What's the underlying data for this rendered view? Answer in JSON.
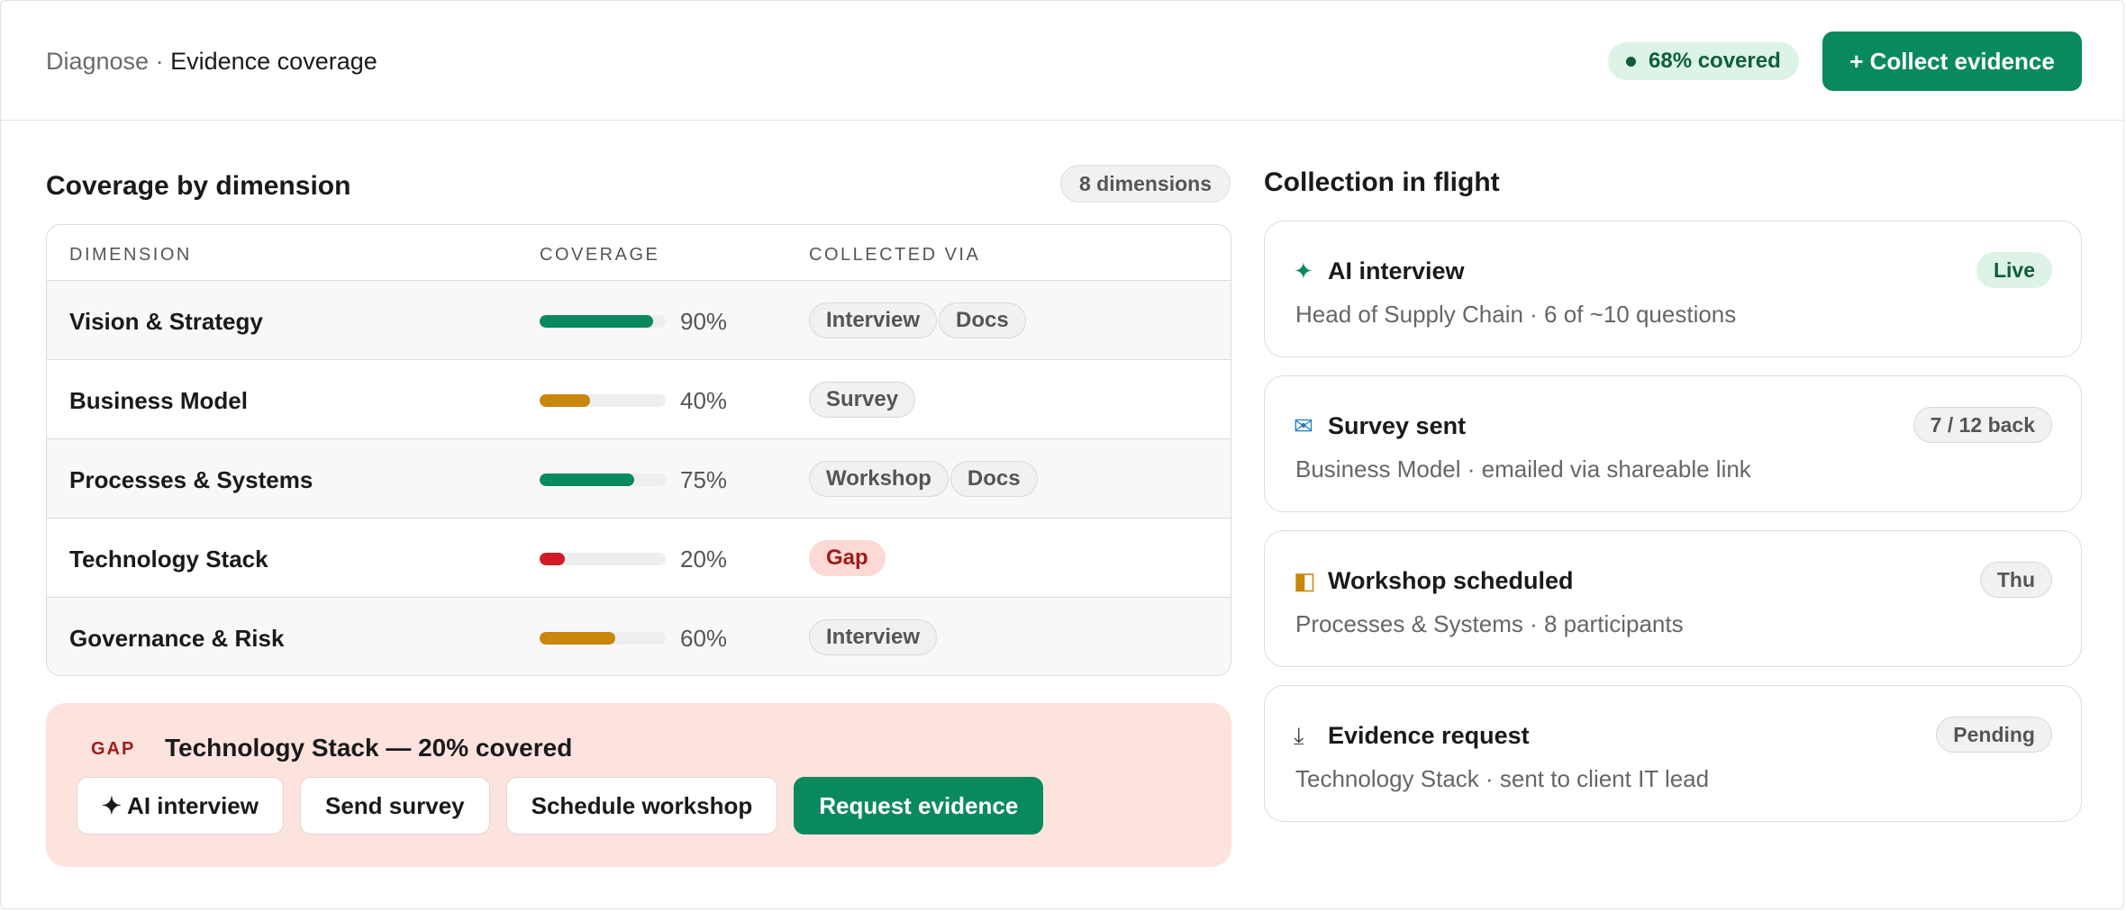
{
  "colors": {
    "accent": "#0a8a5c",
    "green_bar": "#0a8a5c",
    "amber_bar": "#c8860a",
    "red_bar": "#d11a24",
    "gap_bg": "#fde3de"
  },
  "header": {
    "breadcrumb_parent": "Diagnose",
    "breadcrumb_separator": "·",
    "breadcrumb_current": "Evidence coverage",
    "coverage_badge": "68% covered",
    "collect_button": "+ Collect evidence"
  },
  "coverage": {
    "title": "Coverage by dimension",
    "count_badge": "8 dimensions",
    "columns": [
      "DIMENSION",
      "COVERAGE",
      "COLLECTED VIA"
    ],
    "rows": [
      {
        "name": "Vision & Strategy",
        "pct_label": "90%",
        "value": 90,
        "level": "green",
        "via": [
          "Interview",
          "Docs"
        ]
      },
      {
        "name": "Business Model",
        "pct_label": "40%",
        "value": 40,
        "level": "amber",
        "via": [
          "Survey"
        ]
      },
      {
        "name": "Processes & Systems",
        "pct_label": "75%",
        "value": 75,
        "level": "green",
        "via": [
          "Workshop",
          "Docs"
        ]
      },
      {
        "name": "Technology Stack",
        "pct_label": "20%",
        "value": 20,
        "level": "red",
        "via": [
          "Gap"
        ]
      },
      {
        "name": "Governance & Risk",
        "pct_label": "60%",
        "value": 60,
        "level": "amber",
        "via": [
          "Interview"
        ]
      }
    ]
  },
  "gap": {
    "tag": "GAP",
    "title": "Technology Stack — 20% covered",
    "actions": [
      "✦ AI interview",
      "Send survey",
      "Schedule workshop",
      "Request evidence"
    ]
  },
  "in_flight": {
    "title": "Collection in flight",
    "cards": [
      {
        "icon": "sparkle-icon",
        "glyph": "✦",
        "icon_color": "#0a8a5c",
        "title": "AI interview",
        "subtitle": "Head of Supply Chain · 6 of ~10 questions",
        "badge": "Live",
        "badge_style": "live"
      },
      {
        "icon": "mail-icon",
        "glyph": "✉",
        "icon_color": "#1d7bbf",
        "title": "Survey sent",
        "subtitle": "Business Model · emailed via shareable link",
        "badge": "7 / 12 back",
        "badge_style": "neutral"
      },
      {
        "icon": "calendar-icon",
        "glyph": "◧",
        "icon_color": "#c8860a",
        "title": "Workshop scheduled",
        "subtitle": "Processes & Systems · 8 participants",
        "badge": "Thu",
        "badge_style": "neutral"
      },
      {
        "icon": "download-icon",
        "glyph": "⤓",
        "icon_color": "#444444",
        "title": "Evidence request",
        "subtitle": "Technology Stack · sent to client IT lead",
        "badge": "Pending",
        "badge_style": "neutral"
      }
    ]
  }
}
